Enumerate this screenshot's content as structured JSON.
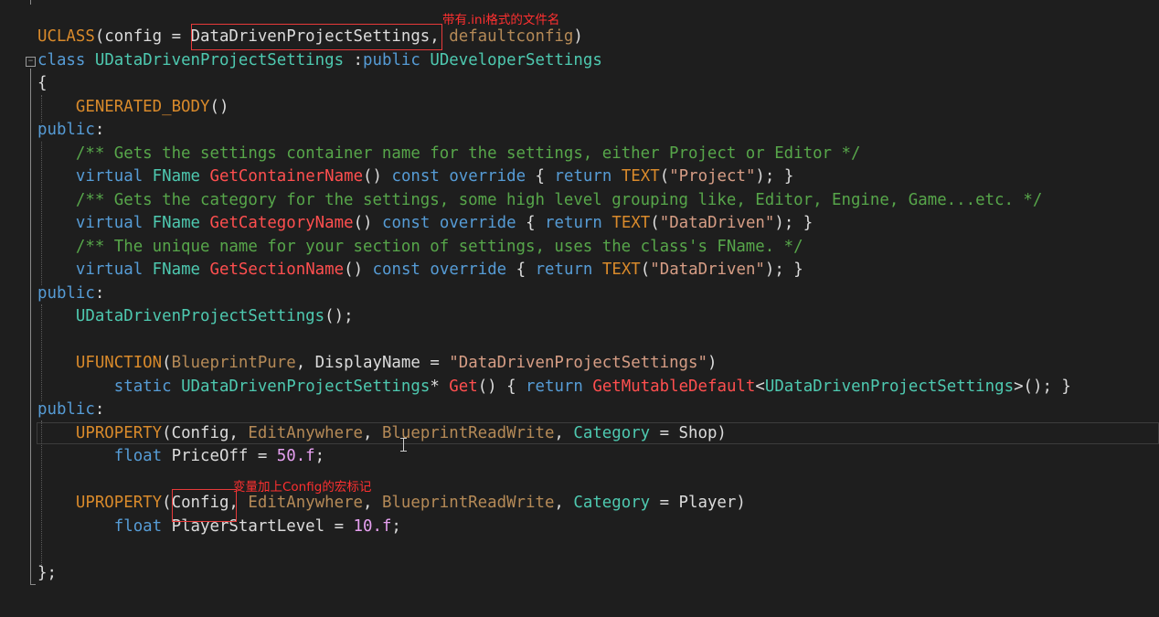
{
  "colors": {
    "background": "#1e1e1e",
    "keyword": "#569cd6",
    "type": "#4ec9b0",
    "macro": "#d98a2b",
    "function": "#ff4f4f",
    "comment": "#57a64a",
    "string": "#d69d85",
    "number": "#e6a0f0",
    "annotation": "#ff3030"
  },
  "annotations": {
    "filename_note": "带有.ini格式的文件名",
    "config_note": "变量加上Config的宏标记"
  },
  "code_lines": [
    [
      [
        "UCLASS",
        "m"
      ],
      [
        "(config = ",
        "p"
      ],
      [
        "DataDrivenProjectSettings",
        "p"
      ],
      [
        ", ",
        "p"
      ],
      [
        "defaultconfig",
        "o"
      ],
      [
        ")",
        "p"
      ]
    ],
    [
      [
        "class",
        "k"
      ],
      [
        " ",
        "p"
      ],
      [
        "UDataDrivenProjectSettings",
        "t"
      ],
      [
        " :",
        "p"
      ],
      [
        "public",
        "k"
      ],
      [
        " ",
        "p"
      ],
      [
        "UDeveloperSettings",
        "t"
      ]
    ],
    [
      [
        "{",
        "p"
      ]
    ],
    [
      [
        "    ",
        "p"
      ],
      [
        "GENERATED_BODY",
        "m"
      ],
      [
        "()",
        "p"
      ]
    ],
    [
      [
        "public",
        "k"
      ],
      [
        ":",
        "p"
      ]
    ],
    [
      [
        "    ",
        "p"
      ],
      [
        "/** Gets the settings container name for the settings, either Project or Editor */",
        "c"
      ]
    ],
    [
      [
        "    ",
        "p"
      ],
      [
        "virtual",
        "k"
      ],
      [
        " ",
        "p"
      ],
      [
        "FName",
        "t"
      ],
      [
        " ",
        "p"
      ],
      [
        "GetContainerName",
        "f"
      ],
      [
        "() ",
        "p"
      ],
      [
        "const",
        "k"
      ],
      [
        " ",
        "p"
      ],
      [
        "override",
        "k"
      ],
      [
        " { ",
        "p"
      ],
      [
        "return",
        "k"
      ],
      [
        " ",
        "p"
      ],
      [
        "TEXT",
        "m"
      ],
      [
        "(",
        "p"
      ],
      [
        "\"Project\"",
        "s"
      ],
      [
        "); }",
        "p"
      ]
    ],
    [
      [
        "    ",
        "p"
      ],
      [
        "/** Gets the category for the settings, some high level grouping like, Editor, Engine, Game...etc. */",
        "c"
      ]
    ],
    [
      [
        "    ",
        "p"
      ],
      [
        "virtual",
        "k"
      ],
      [
        " ",
        "p"
      ],
      [
        "FName",
        "t"
      ],
      [
        " ",
        "p"
      ],
      [
        "GetCategoryName",
        "f"
      ],
      [
        "() ",
        "p"
      ],
      [
        "const",
        "k"
      ],
      [
        " ",
        "p"
      ],
      [
        "override",
        "k"
      ],
      [
        " { ",
        "p"
      ],
      [
        "return",
        "k"
      ],
      [
        " ",
        "p"
      ],
      [
        "TEXT",
        "m"
      ],
      [
        "(",
        "p"
      ],
      [
        "\"DataDriven\"",
        "s"
      ],
      [
        "); }",
        "p"
      ]
    ],
    [
      [
        "    ",
        "p"
      ],
      [
        "/** The unique name for your section of settings, uses the class's FName. */",
        "c"
      ]
    ],
    [
      [
        "    ",
        "p"
      ],
      [
        "virtual",
        "k"
      ],
      [
        " ",
        "p"
      ],
      [
        "FName",
        "t"
      ],
      [
        " ",
        "p"
      ],
      [
        "GetSectionName",
        "f"
      ],
      [
        "() ",
        "p"
      ],
      [
        "const",
        "k"
      ],
      [
        " ",
        "p"
      ],
      [
        "override",
        "k"
      ],
      [
        " { ",
        "p"
      ],
      [
        "return",
        "k"
      ],
      [
        " ",
        "p"
      ],
      [
        "TEXT",
        "m"
      ],
      [
        "(",
        "p"
      ],
      [
        "\"DataDriven\"",
        "s"
      ],
      [
        "); }",
        "p"
      ]
    ],
    [
      [
        "public",
        "k"
      ],
      [
        ":",
        "p"
      ]
    ],
    [
      [
        "    ",
        "p"
      ],
      [
        "UDataDrivenProjectSettings",
        "t"
      ],
      [
        "();",
        "p"
      ]
    ],
    [
      [
        "",
        "p"
      ]
    ],
    [
      [
        "    ",
        "p"
      ],
      [
        "UFUNCTION",
        "m"
      ],
      [
        "(",
        "p"
      ],
      [
        "BlueprintPure",
        "o"
      ],
      [
        ", DisplayName = ",
        "p"
      ],
      [
        "\"DataDrivenProjectSettings\"",
        "s"
      ],
      [
        ")",
        "p"
      ]
    ],
    [
      [
        "        ",
        "p"
      ],
      [
        "static",
        "k"
      ],
      [
        " ",
        "p"
      ],
      [
        "UDataDrivenProjectSettings",
        "t"
      ],
      [
        "* ",
        "p"
      ],
      [
        "Get",
        "f"
      ],
      [
        "() { ",
        "p"
      ],
      [
        "return",
        "k"
      ],
      [
        " ",
        "p"
      ],
      [
        "GetMutableDefault",
        "f"
      ],
      [
        "<",
        "p"
      ],
      [
        "UDataDrivenProjectSettings",
        "t"
      ],
      [
        ">(); }",
        "p"
      ]
    ],
    [
      [
        "public",
        "k"
      ],
      [
        ":",
        "p"
      ]
    ],
    [
      [
        "    ",
        "p"
      ],
      [
        "UPROPERTY",
        "m"
      ],
      [
        "(Config, ",
        "p"
      ],
      [
        "EditAnywhere",
        "o"
      ],
      [
        ", ",
        "p"
      ],
      [
        "BlueprintReadWrite",
        "o"
      ],
      [
        ", ",
        "p"
      ],
      [
        "Category",
        "t"
      ],
      [
        " = Shop)",
        "p"
      ]
    ],
    [
      [
        "        ",
        "p"
      ],
      [
        "float",
        "k"
      ],
      [
        " PriceOff = ",
        "p"
      ],
      [
        "50.f",
        "n"
      ],
      [
        ";",
        "p"
      ]
    ],
    [
      [
        "",
        "p"
      ]
    ],
    [
      [
        "    ",
        "p"
      ],
      [
        "UPROPERTY",
        "m"
      ],
      [
        "(Config, ",
        "p"
      ],
      [
        "EditAnywhere",
        "o"
      ],
      [
        ", ",
        "p"
      ],
      [
        "BlueprintReadWrite",
        "o"
      ],
      [
        ", ",
        "p"
      ],
      [
        "Category",
        "t"
      ],
      [
        " = Player)",
        "p"
      ]
    ],
    [
      [
        "        ",
        "p"
      ],
      [
        "float",
        "k"
      ],
      [
        " PlayerStartLevel = ",
        "p"
      ],
      [
        "10.f",
        "n"
      ],
      [
        ";",
        "p"
      ]
    ],
    [
      [
        "",
        "p"
      ]
    ],
    [
      [
        "",
        "p"
      ]
    ],
    [
      [
        "};",
        "p"
      ]
    ]
  ]
}
